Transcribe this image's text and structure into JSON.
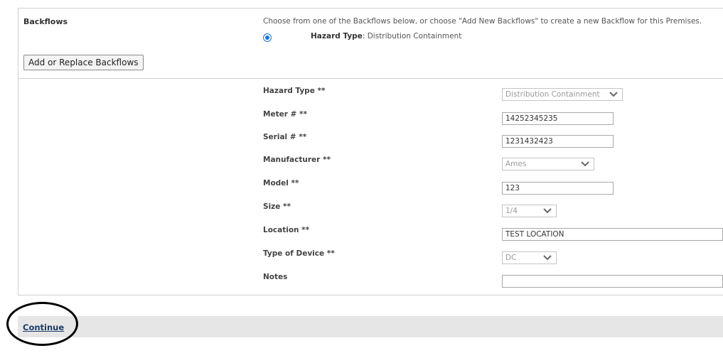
{
  "backflows": {
    "section_label": "Backflows",
    "instructions": "Choose from one of the Backflows below, or choose \"Add New Backflows\" to create a new Backflow for this Premises.",
    "option": {
      "hazard_label": "Hazard Type",
      "hazard_value": "Distribution Containment",
      "selected": true
    },
    "add_button_label": "Add or Replace Backflows"
  },
  "form": {
    "hazard_type": {
      "label": "Hazard Type **",
      "value": "Distribution Containment"
    },
    "meter": {
      "label": "Meter # **",
      "value": "14252345235"
    },
    "serial": {
      "label": "Serial # **",
      "value": "1231432423"
    },
    "manufacturer": {
      "label": "Manufacturer **",
      "value": "Ames"
    },
    "model": {
      "label": "Model **",
      "value": "123"
    },
    "size": {
      "label": "Size **",
      "value": "1/4"
    },
    "location": {
      "label": "Location **",
      "value": "TEST LOCATION"
    },
    "device_type": {
      "label": "Type of Device **",
      "value": "DC"
    },
    "notes": {
      "label": "Notes",
      "value": ""
    }
  },
  "footer": {
    "continue_label": "Continue"
  },
  "colors": {
    "accent": "#1a73e8",
    "link": "#1a3c66",
    "bar": "#e6e6e6",
    "annotation": "#000000"
  },
  "icons": {
    "select_arrow": "chevron-down-icon",
    "radio": "radio-selected-icon"
  }
}
